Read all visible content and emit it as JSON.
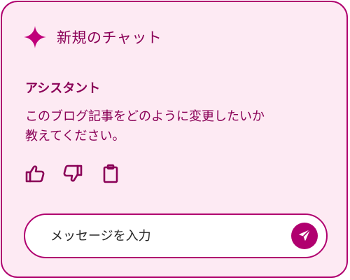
{
  "header": {
    "icon": "sparkle-icon",
    "title": "新規のチャット"
  },
  "message": {
    "sender": "アシスタント",
    "text": "このブログ記事をどのように変更したいか\n教えてください。"
  },
  "actions": [
    {
      "icon": "thumbs-up-icon"
    },
    {
      "icon": "thumbs-down-icon"
    },
    {
      "icon": "clipboard-icon"
    }
  ],
  "composer": {
    "placeholder": "メッセージを入力",
    "value": "",
    "send_icon": "send-icon"
  },
  "colors": {
    "accent": "#b0006f",
    "text": "#8a0057",
    "background": "#fdeaf3",
    "input_background": "#ffffff"
  }
}
